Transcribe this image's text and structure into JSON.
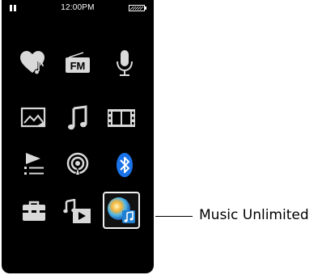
{
  "status": {
    "clock": "12:00PM",
    "left_icon": "pause-icon",
    "right_icon": "battery-icon"
  },
  "menu": {
    "items": [
      {
        "icon": "favorites-heart-music-icon",
        "state": "normal"
      },
      {
        "icon": "fm-radio-icon",
        "label": "FM",
        "state": "normal"
      },
      {
        "icon": "microphone-icon",
        "state": "normal"
      },
      {
        "icon": "photo-icon",
        "state": "normal"
      },
      {
        "icon": "music-note-icon",
        "state": "normal"
      },
      {
        "icon": "video-film-icon",
        "state": "normal"
      },
      {
        "icon": "playlist-icon",
        "state": "normal"
      },
      {
        "icon": "podcast-icon",
        "state": "normal"
      },
      {
        "icon": "bluetooth-icon",
        "state": "normal"
      },
      {
        "icon": "settings-toolbox-icon",
        "state": "normal"
      },
      {
        "icon": "now-playing-icon",
        "state": "normal"
      },
      {
        "icon": "music-unlimited-icon",
        "state": "selected"
      }
    ]
  },
  "callout": {
    "label": "Music Unlimited"
  },
  "colors": {
    "screen_background": "#000000",
    "icon_color": "#d9d9d9",
    "bluetooth": "#1a73e8",
    "callout_text": "#000000"
  }
}
